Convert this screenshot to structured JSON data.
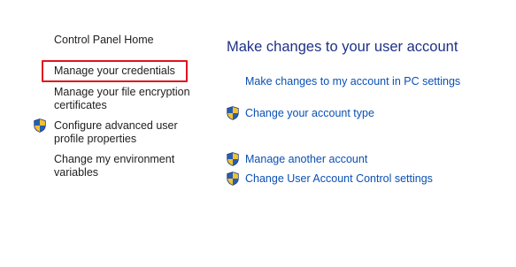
{
  "sidebar": {
    "home_label": "Control Panel Home",
    "items": [
      {
        "line1": "Manage your credentials",
        "line2": ""
      },
      {
        "line1": "Manage your file encryption",
        "line2": "certificates"
      },
      {
        "line1": "Configure advanced user",
        "line2": "profile properties"
      },
      {
        "line1": "Change my environment",
        "line2": "variables"
      }
    ]
  },
  "main": {
    "title": "Make changes to your user account",
    "tasks": [
      {
        "label": "Make changes to my account in PC settings",
        "icon": "none"
      },
      {
        "label": "Change your account type",
        "icon": "uac-shield-icon"
      },
      {
        "label": "Manage another account",
        "icon": "uac-shield-icon"
      },
      {
        "label": "Change User Account Control settings",
        "icon": "uac-shield-icon"
      }
    ]
  },
  "colors": {
    "highlight_border": "#e1141e",
    "title": "#1e3287",
    "link": "#0a50b4",
    "sidebar_text": "#1e1e1e"
  }
}
